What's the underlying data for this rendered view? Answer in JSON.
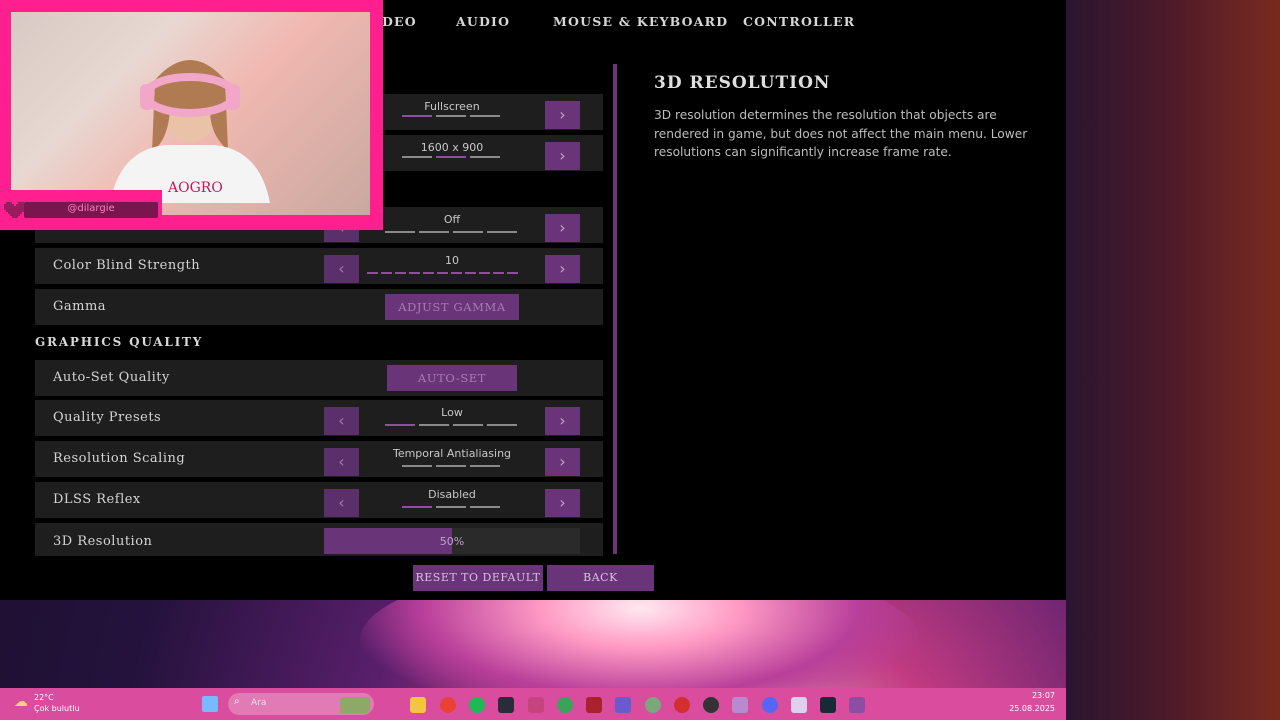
{
  "tabs": [
    "DEO",
    "AUDIO",
    "MOUSE & KEYBOARD",
    "CONTROLLER"
  ],
  "rows_top": [
    {
      "value": "Fullscreen"
    },
    {
      "value": "1600 x 900"
    },
    {
      "value": "Off"
    }
  ],
  "color_blind": {
    "label": "Color Blind Strength",
    "value": "10"
  },
  "gamma": {
    "label": "Gamma",
    "button": "ADJUST GAMMA"
  },
  "section_graphics": "GRAPHICS QUALITY",
  "auto_set": {
    "label": "Auto-Set Quality",
    "button": "AUTO-SET"
  },
  "quality_presets": {
    "label": "Quality Presets",
    "value": "Low"
  },
  "resolution_scaling": {
    "label": "Resolution Scaling",
    "value": "Temporal Antialiasing"
  },
  "dlss_reflex": {
    "label": "DLSS Reflex",
    "value": "Disabled"
  },
  "resolution_3d": {
    "label": "3D Resolution",
    "value": "50%",
    "fraction": 0.5
  },
  "description": {
    "title": "3D RESOLUTION",
    "text": "3D resolution determines the resolution that objects are rendered in game, but does not affect the main menu.  Lower resolutions can significantly increase frame rate."
  },
  "footer": {
    "reset": "RESET TO DEFAULT",
    "back": "BACK"
  },
  "webcam": {
    "handle": "@dilargie"
  },
  "taskbar": {
    "temp": "22°C",
    "condition": "Çok bulutlu",
    "search_placeholder": "Ara",
    "time": "23:07",
    "date": "25.08.2025"
  },
  "colors": {
    "accent": "#6a3478",
    "overlay": "#ff1f8e",
    "taskbar": "#d94c9e"
  }
}
